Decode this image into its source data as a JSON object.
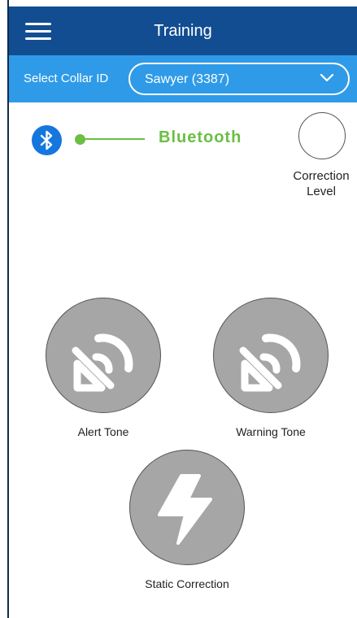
{
  "header": {
    "title": "Training",
    "menu_icon": "hamburger-menu-icon"
  },
  "collar": {
    "label": "Select Collar ID",
    "selected": "Sawyer (3387)",
    "dropdown_icon": "chevron-down-icon"
  },
  "bluetooth": {
    "icon": "bluetooth-icon",
    "callout_label": "Bluetooth"
  },
  "correction_level": {
    "label_line1": "Correction",
    "label_line2": "Level"
  },
  "actions": [
    {
      "label": "Alert Tone",
      "icon": "tone-icon"
    },
    {
      "label": "Warning Tone",
      "icon": "tone-icon"
    },
    {
      "label": "Static Correction",
      "icon": "lightning-bolt-icon"
    }
  ],
  "colors": {
    "header_bg": "#124d92",
    "collar_bar_bg": "#2f9be8",
    "bluetooth_blue": "#1577dd",
    "callout_green": "#6cbe45",
    "button_gray": "#a6a6a6"
  }
}
